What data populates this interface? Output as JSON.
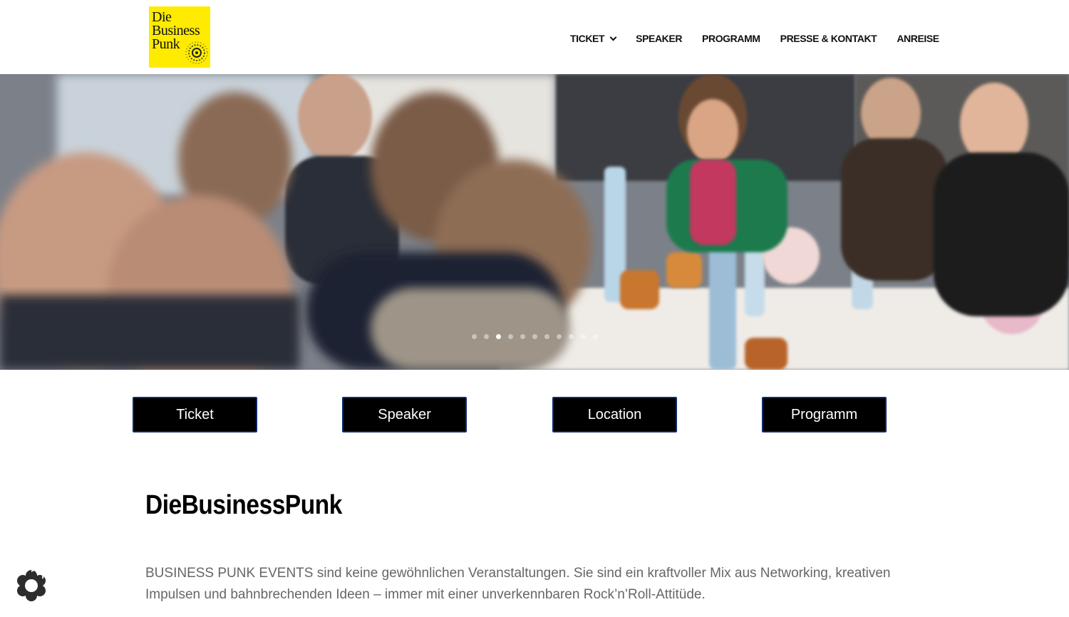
{
  "logo": {
    "lines": [
      "Die",
      "Business",
      "Punk"
    ],
    "accent": "#ffeb00"
  },
  "nav": {
    "items": [
      {
        "label": "TICKET",
        "has_dropdown": true
      },
      {
        "label": "SPEAKER"
      },
      {
        "label": "PROGRAMM"
      },
      {
        "label": "PRESSE & KONTAKT"
      },
      {
        "label": "ANREISE"
      }
    ]
  },
  "hero": {
    "slide_count": 11,
    "active_slide": 3
  },
  "buttons": [
    {
      "label": "Ticket"
    },
    {
      "label": "Speaker"
    },
    {
      "label": "Location"
    },
    {
      "label": "Programm"
    }
  ],
  "content": {
    "title": "DieBusinessPunk",
    "paragraph": "BUSINESS PUNK EVENTS sind keine gewöhnlichen Veranstaltungen. Sie sind ein kraftvoller Mix aus Networking, kreativen Impulsen und bahnbrechenden Ideen – immer mit einer unverkennbaren Rock’n’Roll-Attitüde."
  },
  "colors": {
    "button_bg": "#000000",
    "button_border": "#0d2a6e",
    "text_gray": "#666666"
  },
  "icons": {
    "cookie": "cookie-settings-icon",
    "dropdown": "chevron-down-icon"
  }
}
